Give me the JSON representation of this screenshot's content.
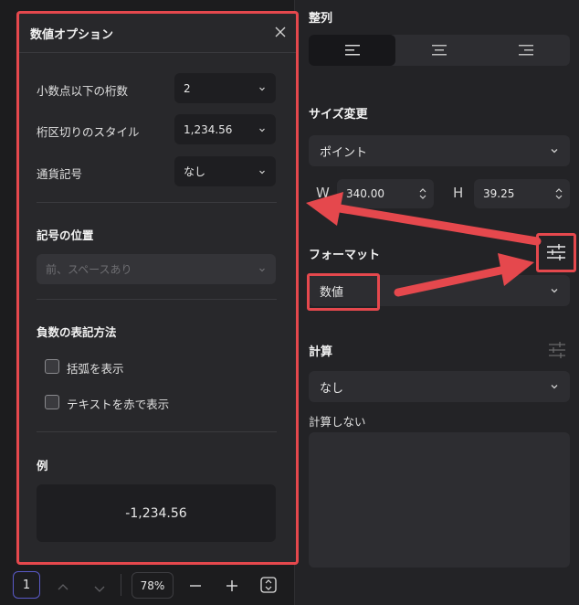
{
  "dialog": {
    "title": "数値オプション",
    "decimal_label": "小数点以下の桁数",
    "decimal_value": "2",
    "separator_label": "桁区切りのスタイル",
    "separator_value": "1,234.56",
    "currency_label": "通貨記号",
    "currency_value": "なし",
    "symbol_position_title": "記号の位置",
    "symbol_position_value": "前、スペースあり",
    "negative_title": "負数の表記方法",
    "paren_label": "括弧を表示",
    "red_label": "テキストを赤で表示",
    "example_title": "例",
    "example_value": "-1,234.56"
  },
  "panel": {
    "align_title": "整列",
    "size_title": "サイズ変更",
    "size_unit": "ポイント",
    "w_label": "W",
    "w_value": "340.00",
    "h_label": "H",
    "h_value": "39.25",
    "format_title": "フォーマット",
    "format_value": "数値",
    "calc_title": "計算",
    "calc_value": "なし",
    "calc_none_label": "計算しない"
  },
  "bottom": {
    "page": "1",
    "zoom": "78%"
  },
  "colors": {
    "accent_red": "#e5484d",
    "page_border": "#5a5ac8"
  },
  "icons": [
    "close-icon",
    "chevron-down-icon",
    "align-left-icon",
    "align-center-icon",
    "align-right-icon",
    "sliders-icon",
    "chevron-up-icon",
    "minus-icon",
    "plus-icon",
    "fit-page-icon"
  ]
}
